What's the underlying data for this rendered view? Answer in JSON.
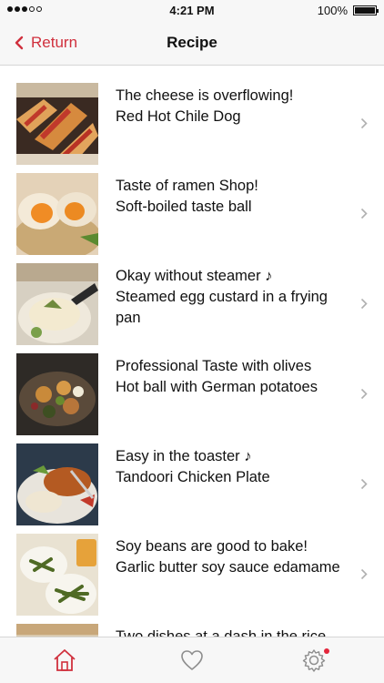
{
  "status_bar": {
    "time": "4:21 PM",
    "battery": "100%"
  },
  "nav": {
    "back_label": "Return",
    "title": "Recipe"
  },
  "recipes": [
    {
      "line1": "The cheese is overflowing!",
      "line2": "Red Hot Chile Dog"
    },
    {
      "line1": "Taste of ramen Shop!",
      "line2": "Soft-boiled taste ball"
    },
    {
      "line1": "Okay without steamer ♪",
      "line2": "Steamed egg custard in a frying pan"
    },
    {
      "line1": "Professional Taste with olives",
      "line2": "Hot ball with German potatoes"
    },
    {
      "line1": "Easy in the toaster ♪",
      "line2": "Tandoori Chicken Plate"
    },
    {
      "line1": "Soy beans are good to bake!",
      "line2": "Garlic butter soy sauce edamame"
    },
    {
      "line1": "Two dishes at a dash in the rice",
      "line2": ""
    }
  ],
  "tabs": [
    {
      "icon": "home-icon",
      "active": true
    },
    {
      "icon": "heart-icon",
      "active": false
    },
    {
      "icon": "gear-icon",
      "active": false,
      "badge": true
    }
  ],
  "colors": {
    "accent": "#d0303d",
    "badge": "#e3263b",
    "bar_bg": "#f7f7f7"
  }
}
